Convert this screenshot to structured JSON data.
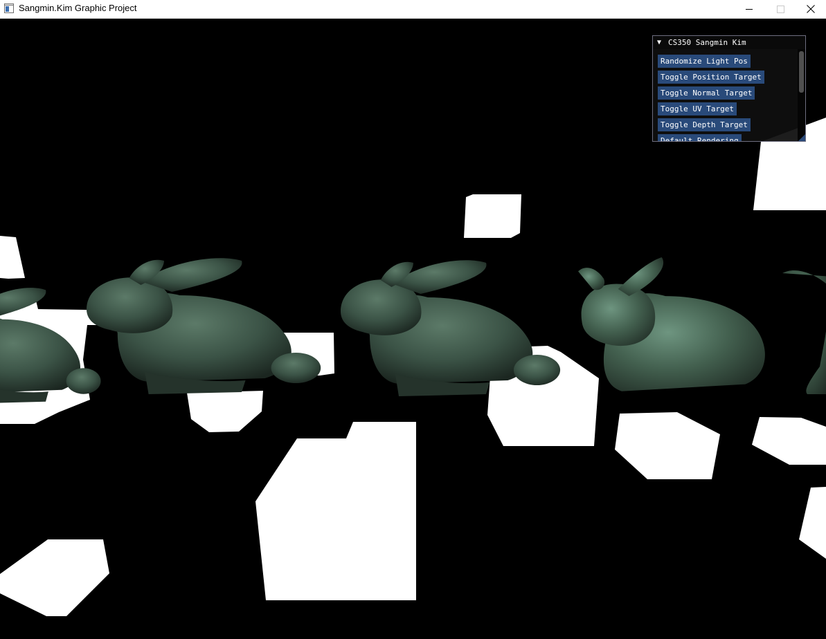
{
  "window": {
    "title": "Sangmin.Kim Graphic Project",
    "icon": "app-window-icon",
    "controls": [
      "minimize-icon",
      "maximize-icon",
      "close-icon"
    ]
  },
  "scene": {
    "description_icon": "bunny-model",
    "background_color": "#000000",
    "bunny_color": "#3f5a4c",
    "highlight_color": "#7aa68e"
  },
  "imgui": {
    "title": "CS350 Sangmin Kim",
    "collapse_glyph": "▼",
    "buttons": [
      "Randomize Light Pos",
      "Toggle Position Target",
      "Toggle Normal Target",
      "Toggle UV Target",
      "Toggle Depth Target",
      "Default Rendering"
    ],
    "button_color": "#294a7a",
    "bg_color": "#0f0f0f"
  }
}
